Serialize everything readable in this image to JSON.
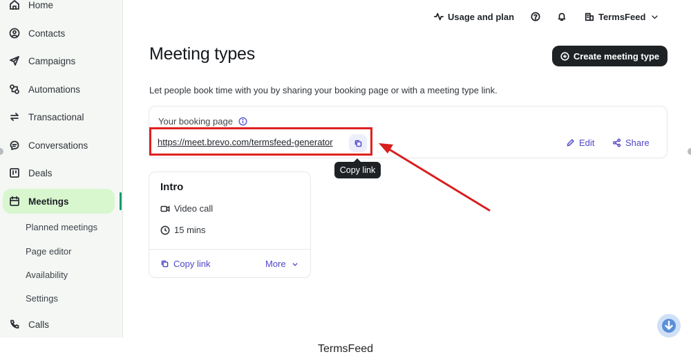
{
  "sidebar": {
    "items": [
      {
        "label": "Home",
        "icon": "home-icon"
      },
      {
        "label": "Contacts",
        "icon": "contacts-icon"
      },
      {
        "label": "Campaigns",
        "icon": "send-icon"
      },
      {
        "label": "Automations",
        "icon": "automation-icon"
      },
      {
        "label": "Transactional",
        "icon": "arrows-icon"
      },
      {
        "label": "Conversations",
        "icon": "chat-icon"
      },
      {
        "label": "Deals",
        "icon": "board-icon"
      },
      {
        "label": "Meetings",
        "icon": "calendar-icon",
        "active": true
      },
      {
        "label": "Calls",
        "icon": "phone-icon"
      }
    ],
    "sub_items": [
      "Planned meetings",
      "Page editor",
      "Availability",
      "Settings"
    ]
  },
  "topbar": {
    "usage": "Usage and plan",
    "account": "TermsFeed"
  },
  "main": {
    "title": "Meeting types",
    "create_button": "Create meeting type",
    "subtitle": "Let people book time with you by sharing your booking page or with a meeting type link.",
    "booking": {
      "label": "Your booking page",
      "link": "https://meet.brevo.com/termsfeed-generator",
      "edit": "Edit",
      "share": "Share",
      "tooltip": "Copy link"
    },
    "meeting_card": {
      "title": "Intro",
      "type": "Video call",
      "duration": "15 mins",
      "copy": "Copy link",
      "more": "More"
    }
  },
  "footer": "TermsFeed",
  "colors": {
    "accent": "#4f46c8",
    "active_bg": "#d9f7cf",
    "highlight": "#e02020"
  }
}
